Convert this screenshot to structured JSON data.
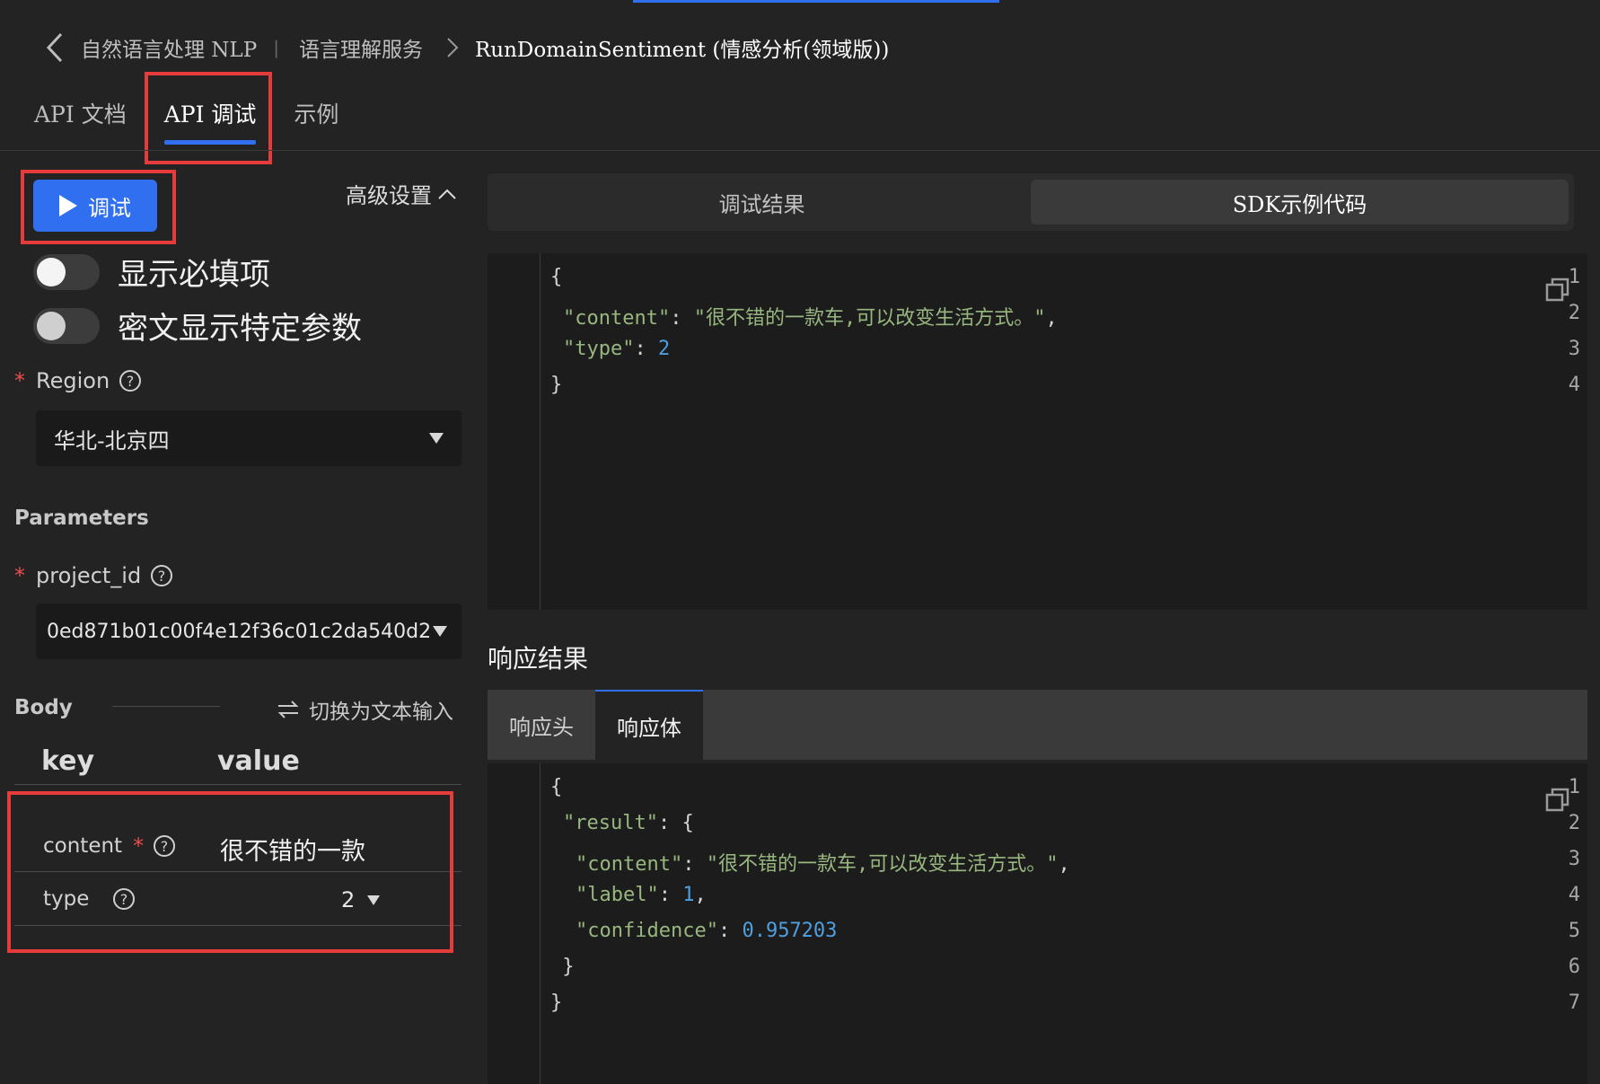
{
  "breadcrumb": {
    "item1": "自然语言处理 NLP",
    "sep": "|",
    "item2": "语言理解服务",
    "current": "RunDomainSentiment (情感分析(领域版))"
  },
  "tabs": [
    {
      "label": "API 文档"
    },
    {
      "label": "API 调试"
    },
    {
      "label": "示例"
    }
  ],
  "left": {
    "run_label": "调试",
    "advanced_label": "高级设置",
    "toggle_required": "显示必填项",
    "toggle_cipher": "密文显示特定参数",
    "region_label": "Region",
    "region_value": "华北-北京四",
    "parameters_label": "Parameters",
    "project_label": "project_id",
    "project_value": "0ed871b01c00f4e12f36c01c2da540d2",
    "body_label": "Body",
    "switch_label": "切换为文本输入",
    "key_header": "key",
    "value_header": "value",
    "rows": [
      {
        "key": "content",
        "value": "很不错的一款"
      },
      {
        "key": "type",
        "value": "2"
      }
    ]
  },
  "right": {
    "tab_result": "调试结果",
    "tab_sdk": "SDK示例代码",
    "request_lines": [
      {
        "n": "1",
        "t": "{"
      },
      {
        "n": "2",
        "key": "\"content\"",
        "colon": ": ",
        "str": "\"很不错的一款车,可以改变生活方式。\"",
        "tail": ","
      },
      {
        "n": "3",
        "key": "\"type\"",
        "colon": ": ",
        "num": "2"
      },
      {
        "n": "4",
        "t": "}"
      }
    ],
    "response_title": "响应结果",
    "resp_tab_header": "响应头",
    "resp_tab_body": "响应体",
    "response_lines": [
      {
        "n": "1",
        "t": "{"
      },
      {
        "n": "2",
        "key": "\"result\"",
        "colon": ": ",
        "tail": "{"
      },
      {
        "n": "3",
        "key": "\"content\"",
        "colon": ": ",
        "str": "\"很不错的一款车,可以改变生活方式。\"",
        "tail": ","
      },
      {
        "n": "4",
        "key": "\"label\"",
        "colon": ": ",
        "num": "1",
        "tail": ","
      },
      {
        "n": "5",
        "key": "\"confidence\"",
        "colon": ": ",
        "num": "0.957203"
      },
      {
        "n": "6",
        "t": " }"
      },
      {
        "n": "7",
        "t": "}"
      }
    ]
  },
  "colors": {
    "accent": "#2f6ff0",
    "highlight_box": "#e63b3b",
    "background": "#232323"
  }
}
